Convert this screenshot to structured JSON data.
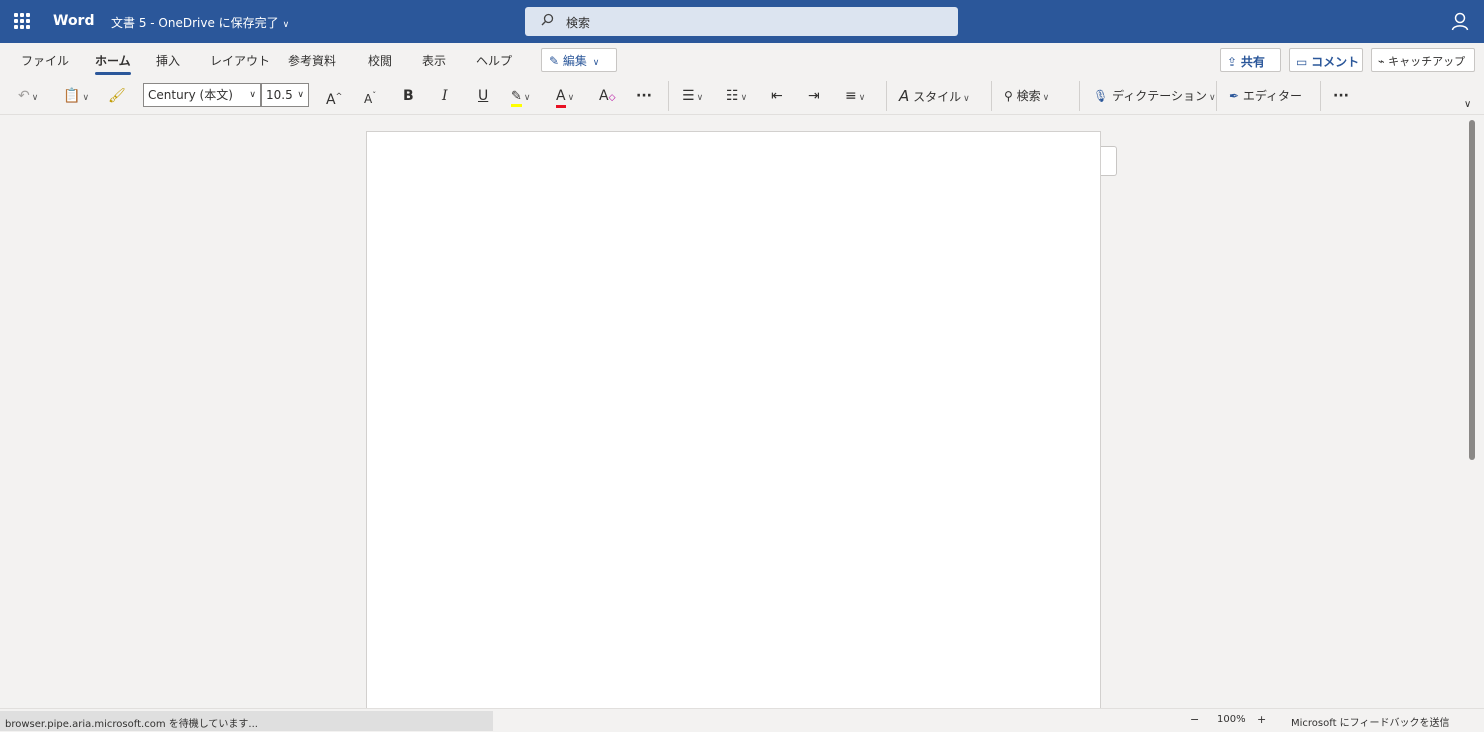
{
  "titlebar": {
    "app_name": "Word",
    "doc_title": "文書 5 - OneDrive に保存完了",
    "search_placeholder": "検索"
  },
  "tabs": [
    {
      "label": "ファイル"
    },
    {
      "label": "ホーム"
    },
    {
      "label": "挿入"
    },
    {
      "label": "レイアウト"
    },
    {
      "label": "参考資料"
    },
    {
      "label": "校閲"
    },
    {
      "label": "表示"
    },
    {
      "label": "ヘルプ"
    }
  ],
  "active_tab": "ホーム",
  "edit_mode_label": "編集",
  "header_actions": {
    "share": "共有",
    "comments": "コメント",
    "catchup": "キャッチアップ"
  },
  "toolbar": {
    "font_name": "Century (本文)",
    "font_size": "10.5",
    "bold": "B",
    "italic": "I",
    "underline": "U",
    "styles_label": "スタイル",
    "find_label": "検索",
    "dictate_label": "ディクテーション",
    "editor_label": "エディター",
    "more": "···"
  },
  "colors": {
    "brand": "#2b579a",
    "highlight": "#ffff00",
    "font_color": "#e81123"
  },
  "statusbar": {
    "loading_message": "browser.pipe.aria.microsoft.com を待機しています...",
    "zoom_out": "−",
    "zoom_level": "100%",
    "zoom_in": "+",
    "feedback": "Microsoft にフィードバックを送信"
  }
}
